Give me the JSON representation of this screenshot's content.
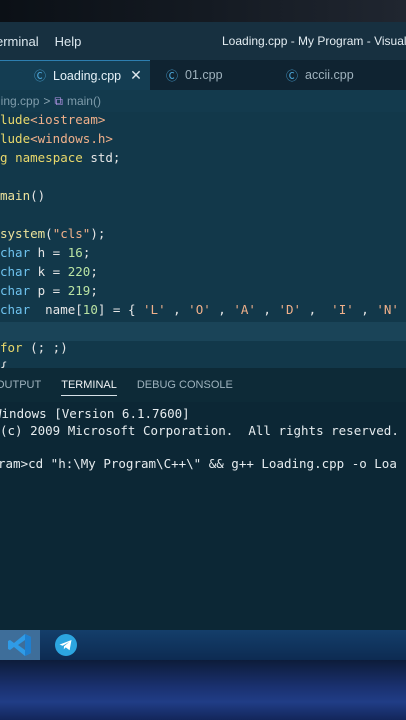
{
  "window": {
    "title": "Loading.cpp - My Program - Visual",
    "menu": [
      "erminal",
      "Help"
    ]
  },
  "tabs": [
    {
      "label": "Loading.cpp",
      "active": true,
      "icon": "c-plus-plus-icon"
    },
    {
      "label": "01.cpp",
      "active": false,
      "icon": "c-plus-plus-icon"
    },
    {
      "label": "accii.cpp",
      "active": false,
      "icon": "c-plus-plus-icon"
    }
  ],
  "breadcrumb": {
    "file": "ding.cpp",
    "separator": ">",
    "symbol": "main()"
  },
  "code": {
    "l1": [
      "lude",
      "<iostream>"
    ],
    "l2": [
      "lude",
      "<windows.h>"
    ],
    "l3": [
      "g ",
      "namespace",
      " std;"
    ],
    "l5": [
      "main",
      "()"
    ],
    "l7": [
      "system",
      "(",
      "\"cls\"",
      ");"
    ],
    "l8": [
      "char",
      " h = ",
      "16",
      ";"
    ],
    "l9": [
      "char",
      " k = ",
      "220",
      ";"
    ],
    "l10": [
      "char",
      " p = ",
      "219",
      ";"
    ],
    "l11": [
      "char",
      "  name[",
      "10",
      "] = { ",
      "'L'",
      " , ",
      "'O'",
      " , ",
      "'A'",
      " , ",
      "'D'",
      " ,  ",
      "'I'",
      " , ",
      "'N'"
    ],
    "l13": [
      "for",
      " (; ;)"
    ],
    "l14": [
      "{"
    ]
  },
  "panel": {
    "tabs": [
      "OUTPUT",
      "TERMINAL",
      "DEBUG CONSOLE"
    ],
    "active": "TERMINAL"
  },
  "terminal": {
    "lines": [
      "Windows [Version 6.1.7600]",
      "(c) 2009 Microsoft Corporation.  All rights reserved.",
      "ram>cd \"h:\\My Program\\C++\\\" && g++ Loading.cpp -o Loa"
    ]
  },
  "taskbar": {
    "items": [
      {
        "icon": "vscode-icon",
        "active": true
      },
      {
        "icon": "telegram-icon",
        "active": false
      }
    ]
  },
  "colors": {
    "editor_bg": "#12384a",
    "keyword": "#e9d86b",
    "type": "#6fc3ef",
    "string": "#f0b08a",
    "number": "#b9e3a3",
    "accent": "#2d7fb0"
  }
}
